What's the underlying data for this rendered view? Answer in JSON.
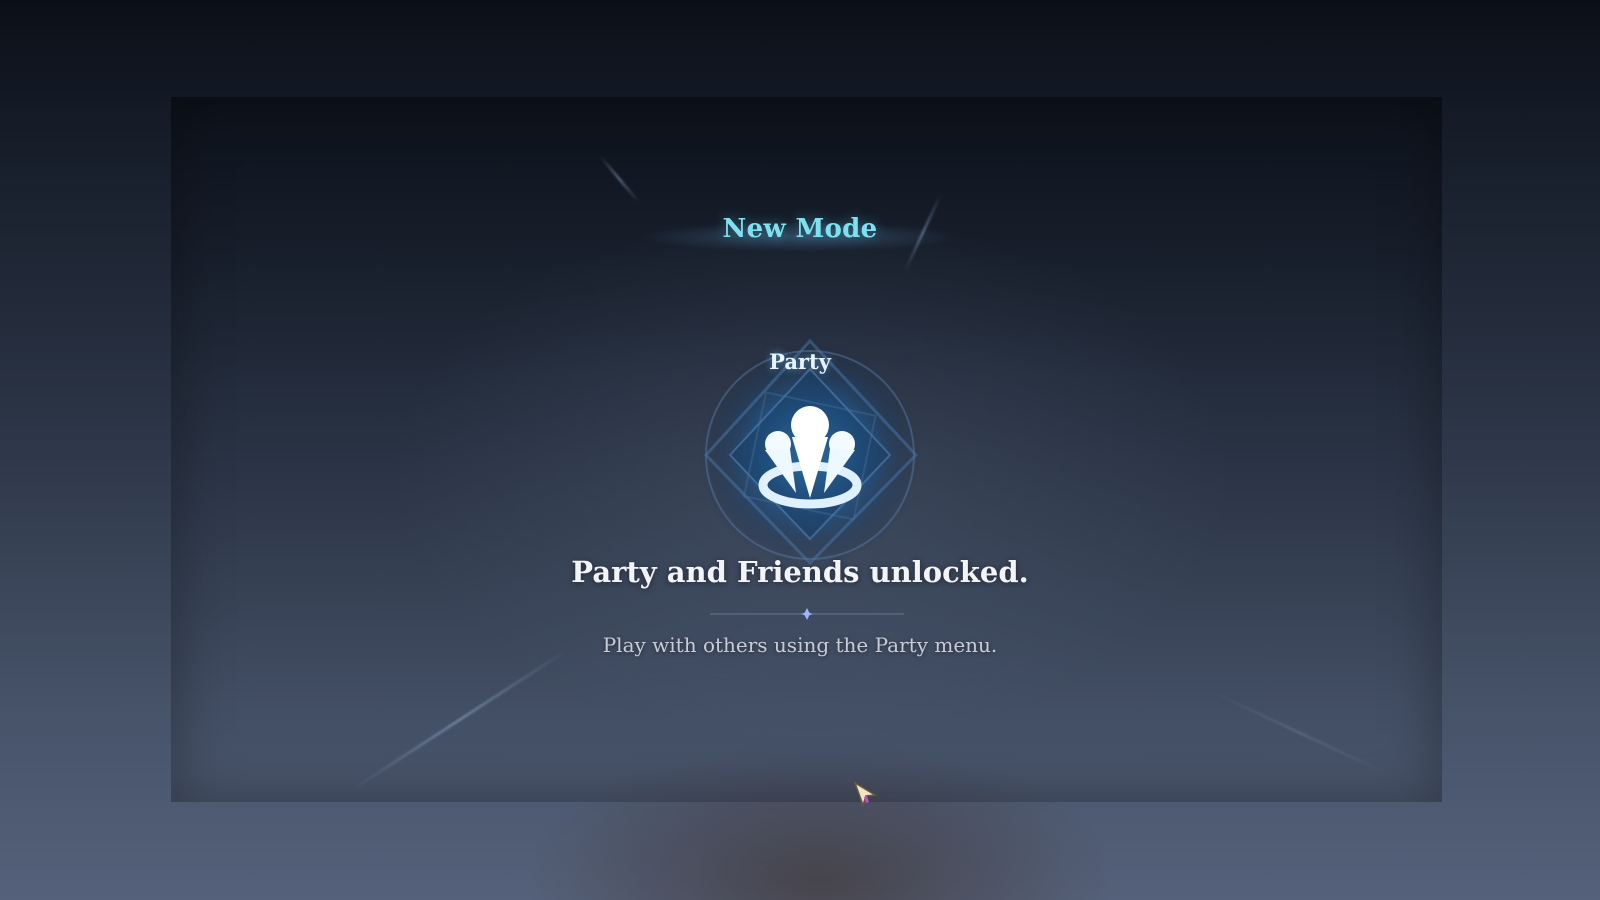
{
  "unlock_popup": {
    "title": "New Mode",
    "emblem_label": "Party",
    "emblem_icon": "party-group-icon",
    "headline": "Party and Friends unlocked.",
    "description": "Play with others using the Party menu."
  },
  "colors": {
    "title": "#7fe0f0",
    "emblem_glow": "#4fb8f0",
    "headline": "#f2f4f8",
    "description": "#c7ccd6",
    "divider_star": "#9fb4ff"
  },
  "cursor_icon": "pointer-cursor-icon"
}
